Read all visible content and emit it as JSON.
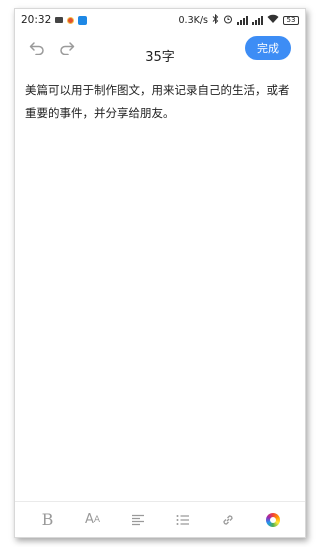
{
  "status_bar": {
    "time": "20:32",
    "network_speed": "0.3K/s",
    "battery": "53",
    "icons": [
      "message-icon",
      "notification-dot-icon",
      "app-notification-icon",
      "bluetooth-icon",
      "alarm-icon",
      "signal-icon",
      "signal-icon",
      "wifi-icon",
      "battery-icon"
    ]
  },
  "header": {
    "undo_icon": "undo-icon",
    "redo_icon": "redo-icon",
    "char_count": "35字",
    "done_label": "完成"
  },
  "editor": {
    "text": "美篇可以用于制作图文，用来记录自己的生活，或者重要的事件，并分享给朋友。"
  },
  "toolbar": {
    "bold_label": "B",
    "font_label_large": "A",
    "font_label_small": "A",
    "icons": [
      "bold-icon",
      "font-size-icon",
      "align-icon",
      "list-icon",
      "link-icon",
      "color-icon"
    ]
  },
  "colors": {
    "accent": "#3d8df5",
    "toolbar_icon": "#9a9a9a",
    "text": "#222222"
  }
}
